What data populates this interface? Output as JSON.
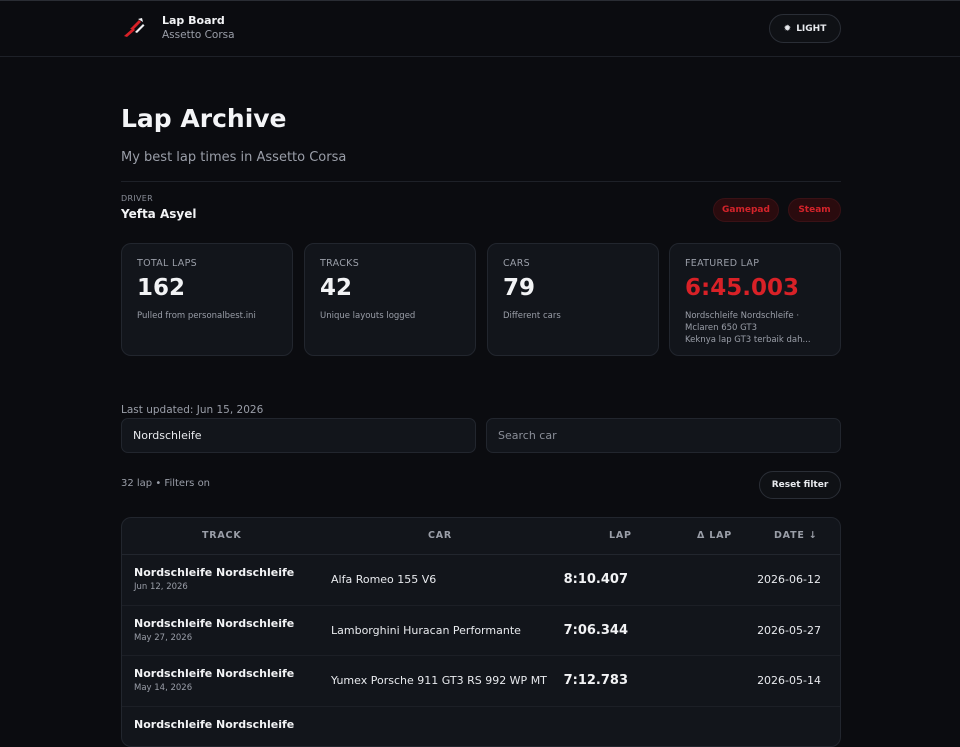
{
  "header": {
    "title": "Lap Board",
    "subtitle": "Assetto Corsa",
    "theme_label": "LIGHT"
  },
  "page": {
    "title": "Lap Archive",
    "subtitle": "My best lap times in Assetto Corsa"
  },
  "driver": {
    "label": "DRIVER",
    "name": "Yefta Asyel",
    "badges": [
      "Gamepad",
      "Steam"
    ]
  },
  "stats": [
    {
      "label": "TOTAL LAPS",
      "value": "162",
      "desc": "Pulled from personalbest.ini"
    },
    {
      "label": "TRACKS",
      "value": "42",
      "desc": "Unique layouts logged"
    },
    {
      "label": "CARS",
      "value": "79",
      "desc": "Different cars"
    },
    {
      "label": "FEATURED LAP",
      "value": "6:45.003",
      "desc1": "Nordschleife Nordschleife ·",
      "desc2": "Mclaren 650 GT3",
      "desc3": "Keknya lap GT3 terbaik dah..."
    }
  ],
  "filters": {
    "updated": "Last updated: Jun 15, 2026",
    "track_value": "Nordschleife",
    "car_placeholder": "Search car",
    "count": "32 lap • Filters on",
    "reset_label": "Reset filter"
  },
  "table": {
    "headers": {
      "track": "TRACK",
      "car": "CAR",
      "lap": "LAP",
      "delta": "Δ LAP",
      "date": "DATE ↓"
    },
    "rows": [
      {
        "track": "Nordschleife Nordschleife",
        "track_date": "Jun 12, 2026",
        "car": "Alfa Romeo 155 V6",
        "lap": "8:10.407",
        "date": "2026-06-12"
      },
      {
        "track": "Nordschleife Nordschleife",
        "track_date": "May 27, 2026",
        "car": "Lamborghini Huracan Performante",
        "lap": "7:06.344",
        "date": "2026-05-27"
      },
      {
        "track": "Nordschleife Nordschleife",
        "track_date": "May 14, 2026",
        "car": "Yumex Porsche 911 GT3 RS 992 WP MT",
        "lap": "7:12.783",
        "date": "2026-05-14"
      },
      {
        "track": "Nordschleife Nordschleife",
        "track_date": "",
        "car": "",
        "lap": "",
        "date": ""
      }
    ]
  },
  "colors": {
    "accent": "#d82127",
    "background": "#0b0c10",
    "card": "#12151b"
  }
}
